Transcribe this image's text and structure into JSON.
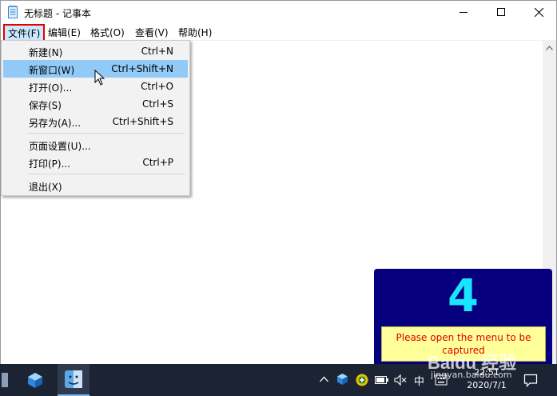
{
  "window": {
    "title": "无标题 - 记事本",
    "icon": "notepad-icon"
  },
  "menubar": {
    "file": "文件(F)",
    "edit": "编辑(E)",
    "format": "格式(O)",
    "view": "查看(V)",
    "help": "帮助(H)"
  },
  "file_menu": {
    "items": [
      {
        "label": "新建(N)",
        "accel": "Ctrl+N"
      },
      {
        "label": "新窗口(W)",
        "accel": "Ctrl+Shift+N",
        "selected": true
      },
      {
        "label": "打开(O)...",
        "accel": "Ctrl+O"
      },
      {
        "label": "保存(S)",
        "accel": "Ctrl+S"
      },
      {
        "label": "另存为(A)...",
        "accel": "Ctrl+Shift+S"
      },
      {
        "label": "页面设置(U)...",
        "accel": ""
      },
      {
        "label": "打印(P)...",
        "accel": "Ctrl+P"
      },
      {
        "label": "退出(X)",
        "accel": ""
      }
    ]
  },
  "overlay": {
    "count": "4",
    "message": "Please open the menu to be captured"
  },
  "watermark": {
    "brand": "Baidu 经验",
    "site": "jingyan.baidu.com"
  },
  "taskbar": {
    "ime": "中",
    "time": "22:51",
    "date": "2020/7/1"
  },
  "colors": {
    "menu_highlight": "#91c9f7",
    "file_menu_outline": "#e60000",
    "overlay_bg": "#07007e",
    "overlay_count": "#19e5ff",
    "hint_bg": "#ffff99",
    "hint_text": "#e00000",
    "taskbar_bg": "#1c2434"
  }
}
